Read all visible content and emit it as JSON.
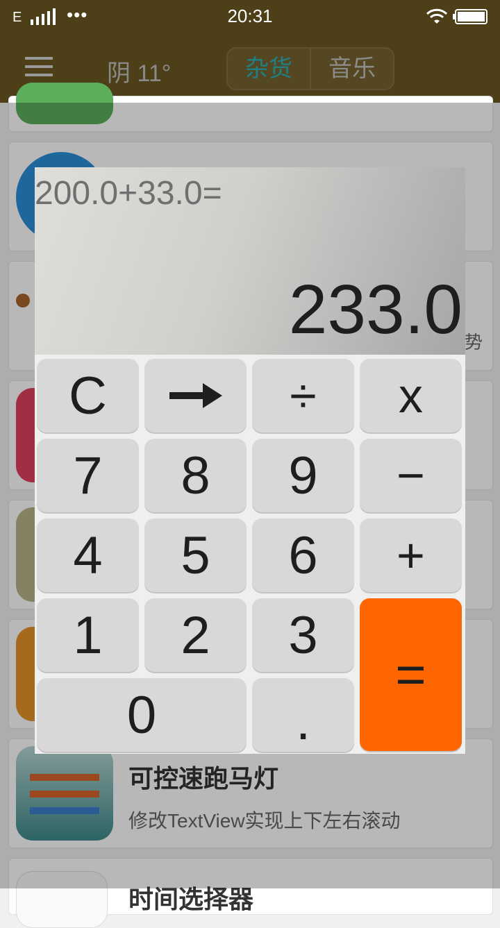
{
  "status_bar": {
    "network": "E",
    "dots": "•••",
    "time": "20:31"
  },
  "toolbar": {
    "weather": "阴 11°",
    "tabs": [
      "杂货",
      "音乐"
    ]
  },
  "list": {
    "visible_items": [
      {
        "title": "可控速跑马灯",
        "subtitle": "修改TextView实现上下左右滚动"
      },
      {
        "title": "时间选择器",
        "subtitle": ""
      }
    ],
    "partial_text": "趋势"
  },
  "calculator": {
    "expression": "200.0+33.0=",
    "result": "233.0",
    "keys": {
      "clear": "C",
      "backspace": "➞",
      "divide": "÷",
      "multiply": "x",
      "seven": "7",
      "eight": "8",
      "nine": "9",
      "minus": "−",
      "four": "4",
      "five": "5",
      "six": "6",
      "plus": "+",
      "one": "1",
      "two": "2",
      "three": "3",
      "equals": "=",
      "zero": "0",
      "dot": "."
    },
    "colors": {
      "equals": "#ff6600",
      "key": "#d8d8d8"
    }
  }
}
